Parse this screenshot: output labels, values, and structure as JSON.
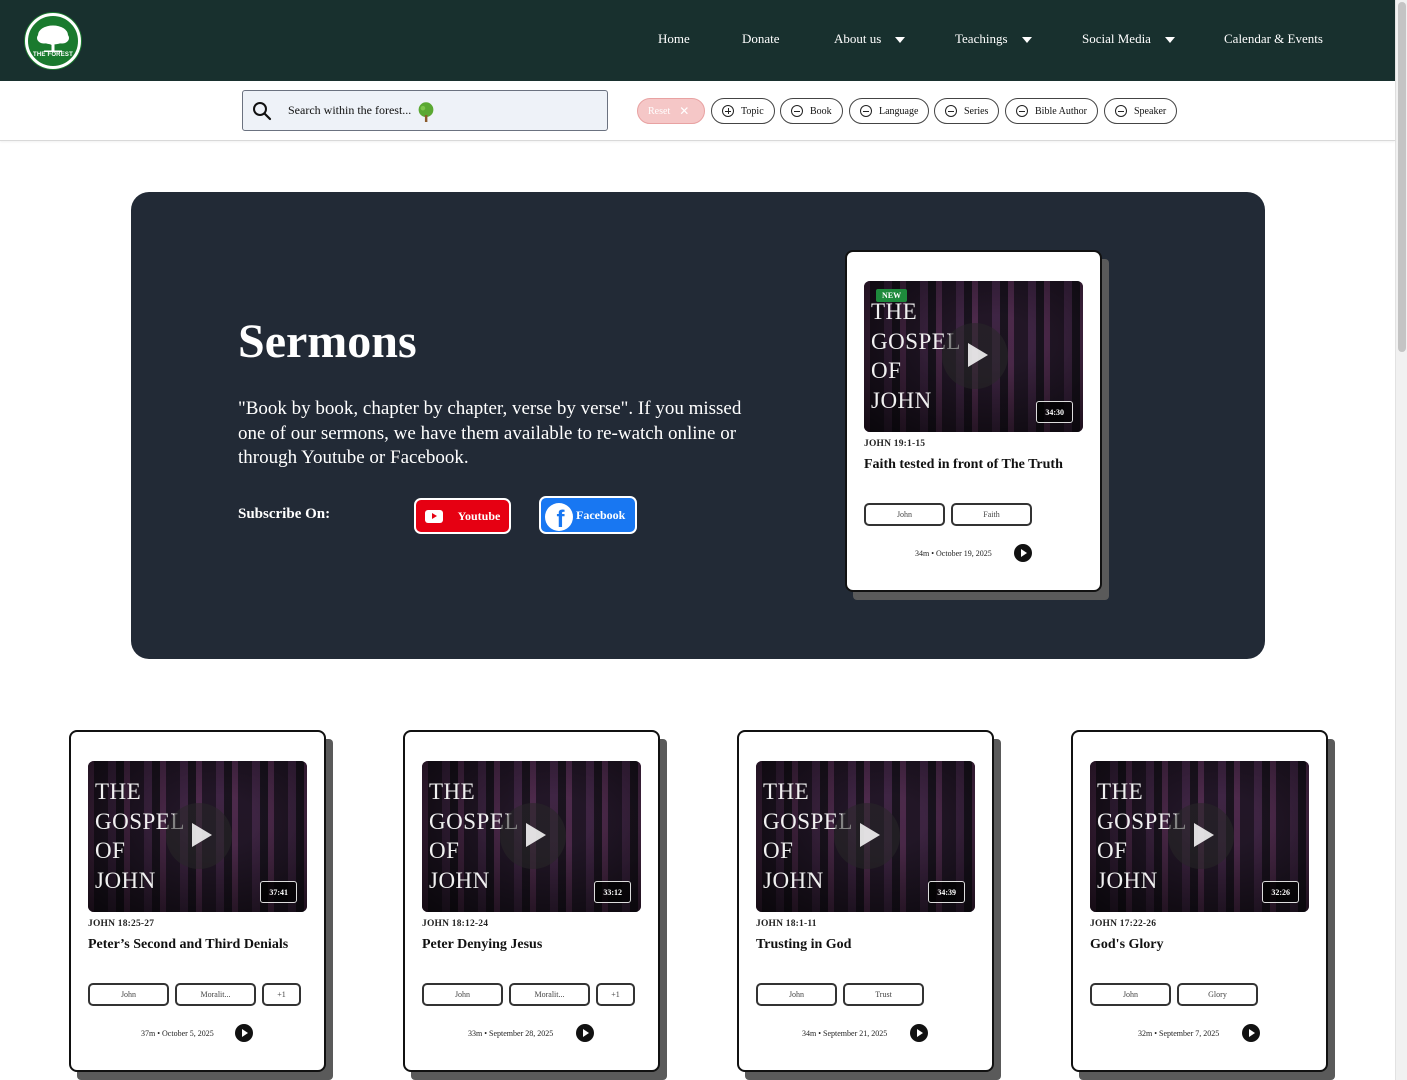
{
  "nav": {
    "logo_text": "THE FOREST",
    "links": [
      "Home",
      "Donate",
      "About us",
      "Teachings",
      "Social Media",
      "Calendar & Events"
    ]
  },
  "search": {
    "placeholder": "Search within the forest...",
    "icon": "search-icon"
  },
  "filters": {
    "reset_label": "Reset",
    "chips": [
      "Topic",
      "Book",
      "Language",
      "Series",
      "Bible Author",
      "Speaker"
    ]
  },
  "hero": {
    "title": "Sermons",
    "description": "\"Book by book, chapter by chapter, verse by verse\". If you missed one of our sermons, we have them available to re-watch online or through Youtube or Facebook.",
    "subscribe_label": "Subscribe On:",
    "youtube_label": "Youtube",
    "facebook_label": "Facebook",
    "background_color": "#222a36"
  },
  "featured": {
    "badge": "NEW",
    "thumb_title": "THE\nGOSPEL\nOF\nJOHN",
    "duration": "34:30",
    "verse": "JOHN 19:1-15",
    "title": "Faith tested in front of The Truth",
    "tags": [
      "John",
      "Faith"
    ],
    "meta": "34m • October 19, 2025"
  },
  "sermons": [
    {
      "thumb_title": "THE\nGOSPEL\nOF\nJOHN",
      "duration": "37:41",
      "verse": "JOHN 18:25-27",
      "title": "Peter’s Second and Third Denials",
      "tags": [
        "John",
        "Moralit...",
        "+1"
      ],
      "meta": "37m • October 5, 2025"
    },
    {
      "thumb_title": "THE\nGOSPEL\nOF\nJOHN",
      "duration": "33:12",
      "verse": "JOHN 18:12-24",
      "title": "Peter Denying Jesus",
      "tags": [
        "John",
        "Moralit...",
        "+1"
      ],
      "meta": "33m • September 28, 2025"
    },
    {
      "thumb_title": "THE\nGOSPEL\nOF\nJOHN",
      "duration": "34:39",
      "verse": "JOHN 18:1-11",
      "title": "Trusting in God",
      "tags": [
        "John",
        "Trust"
      ],
      "meta": "34m • September 21, 2025"
    },
    {
      "thumb_title": "THE\nGOSPEL\nOF\nJOHN",
      "duration": "32:26",
      "verse": "JOHN 17:22-26",
      "title": "God's Glory",
      "tags": [
        "John",
        "Glory"
      ],
      "meta": "32m • September 7, 2025"
    }
  ],
  "colors": {
    "nav": "#18302e",
    "youtube": "#e60012",
    "facebook": "#1877f2",
    "new_badge": "#1e8a3c",
    "reset_chip": "#f5c7c7"
  }
}
